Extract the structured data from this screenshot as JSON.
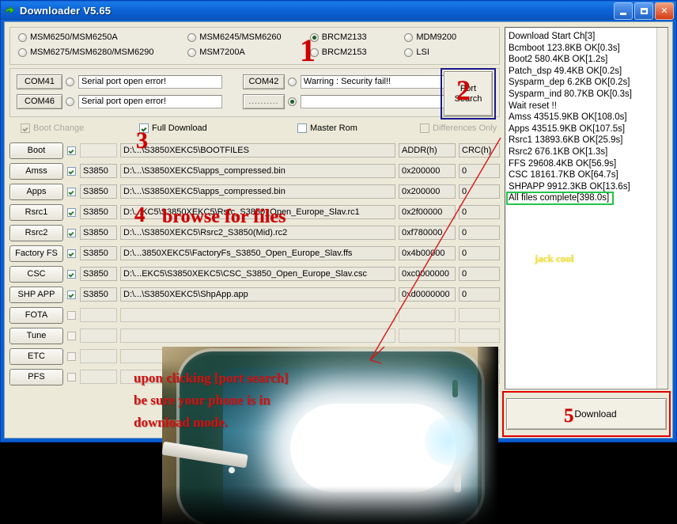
{
  "window": {
    "title": "Downloader V5.65",
    "icon": "app-arrow-icon",
    "buttons": {
      "minimize": "_",
      "maximize": "□",
      "close": "✕"
    }
  },
  "chipset": {
    "columns": [
      [
        {
          "label": "MSM6250/MSM6250A",
          "selected": false
        },
        {
          "label": "MSM6275/MSM6280/MSM6290",
          "selected": false
        }
      ],
      [
        {
          "label": "MSM6245/MSM6260",
          "selected": false
        },
        {
          "label": "MSM7200A",
          "selected": false
        }
      ],
      [
        {
          "label": "BRCM2133",
          "selected": true
        },
        {
          "label": "BRCM2153",
          "selected": false
        }
      ],
      [
        {
          "label": "MDM9200",
          "selected": false
        },
        {
          "label": "LSI",
          "selected": false
        }
      ]
    ]
  },
  "ports": {
    "rows": [
      {
        "left_button": "COM41",
        "left_selected": false,
        "left_status": "Serial port open error!",
        "right_button": "COM42",
        "right_selected": false,
        "right_status": "Warring : Security fail!!"
      },
      {
        "left_button": "COM46",
        "left_selected": false,
        "left_status": "Serial port open error!",
        "right_button": "..........",
        "right_selected": true,
        "right_status": ""
      }
    ],
    "search_button": {
      "line1": "Port",
      "line2": "Search"
    }
  },
  "options": [
    {
      "label": "Boot Change",
      "checked": true,
      "disabled": true
    },
    {
      "label": "Full Download",
      "checked": true,
      "disabled": false
    },
    {
      "label": "Master Rom",
      "checked": false,
      "disabled": false
    },
    {
      "label": "Differences Only",
      "checked": false,
      "disabled": true
    }
  ],
  "file_table": {
    "headers": {
      "addr": "ADDR(h)",
      "crc": "CRC(h)"
    },
    "rows": [
      {
        "button": "Boot",
        "checked": true,
        "version": "",
        "path": "D:\\...\\S3850XEKC5\\BOOTFILES",
        "addr": "",
        "crc": "",
        "is_header": true
      },
      {
        "button": "Amss",
        "checked": true,
        "version": "S3850",
        "path": "D:\\...\\S3850XEKC5\\apps_compressed.bin",
        "addr": "0x200000",
        "crc": "0"
      },
      {
        "button": "Apps",
        "checked": true,
        "version": "S3850",
        "path": "D:\\...\\S3850XEKC5\\apps_compressed.bin",
        "addr": "0x200000",
        "crc": "0"
      },
      {
        "button": "Rsrc1",
        "checked": true,
        "version": "S3850",
        "path": "D:\\...KC5\\S3850XEKC5\\Rsrc_S3850_Open_Europe_Slav.rc1",
        "addr": "0x2f00000",
        "crc": "0"
      },
      {
        "button": "Rsrc2",
        "checked": true,
        "version": "S3850",
        "path": "D:\\...\\S3850XEKC5\\Rsrc2_S3850(Mid).rc2",
        "addr": "0xf780000",
        "crc": "0"
      },
      {
        "button": "Factory FS",
        "checked": true,
        "version": "S3850",
        "path": "D:\\...3850XEKC5\\FactoryFs_S3850_Open_Europe_Slav.ffs",
        "addr": "0x4b00000",
        "crc": "0"
      },
      {
        "button": "CSC",
        "checked": true,
        "version": "S3850",
        "path": "D:\\...EKC5\\S3850XEKC5\\CSC_S3850_Open_Europe_Slav.csc",
        "addr": "0xc0000000",
        "crc": "0"
      },
      {
        "button": "SHP APP",
        "checked": true,
        "version": "S3850",
        "path": "D:\\...\\S3850XEKC5\\ShpApp.app",
        "addr": "0xd0000000",
        "crc": "0"
      },
      {
        "button": "FOTA",
        "checked": false,
        "version": "",
        "path": "",
        "addr": "",
        "crc": ""
      },
      {
        "button": "Tune",
        "checked": false,
        "version": "",
        "path": "",
        "addr": "",
        "crc": ""
      },
      {
        "button": "ETC",
        "checked": false,
        "version": "",
        "path": "",
        "addr": "",
        "crc": ""
      },
      {
        "button": "PFS",
        "checked": false,
        "version": "",
        "path": "",
        "addr": "",
        "crc": ""
      }
    ]
  },
  "log": {
    "lines": [
      "Download Start Ch[3]",
      "Bcmboot 123.8KB OK[0.3s]",
      "Boot2 580.4KB OK[1.2s]",
      "Patch_dsp 49.4KB OK[0.2s]",
      "Sysparm_dep 6.2KB OK[0.2s]",
      "Sysparm_ind 80.7KB OK[0.3s]",
      "Wait reset !!",
      "Amss 43515.9KB OK[108.0s]",
      "Apps 43515.9KB OK[107.5s]",
      "Rsrc1 13893.6KB OK[25.9s]",
      "Rsrc2 676.1KB OK[1.3s]",
      "FFS 29608.4KB OK[56.9s]",
      "CSC 18161.7KB OK[64.7s]",
      "SHPAPP 9912.3KB OK[13.6s]"
    ],
    "complete": "All files complete[398.0s]",
    "watermark": "jack cool",
    "highlight_color": "#22c44a"
  },
  "download_button": {
    "label": "Download"
  },
  "annotations": {
    "step1": "1",
    "step2": "2",
    "step3": "3",
    "step4_number": "4",
    "step4_text": "browse for files",
    "step5": "5",
    "note_line1": "upon clicking [port search]",
    "note_line2": "be sure your phone is in",
    "note_line3": "download mode.",
    "color": "#cc0000"
  }
}
